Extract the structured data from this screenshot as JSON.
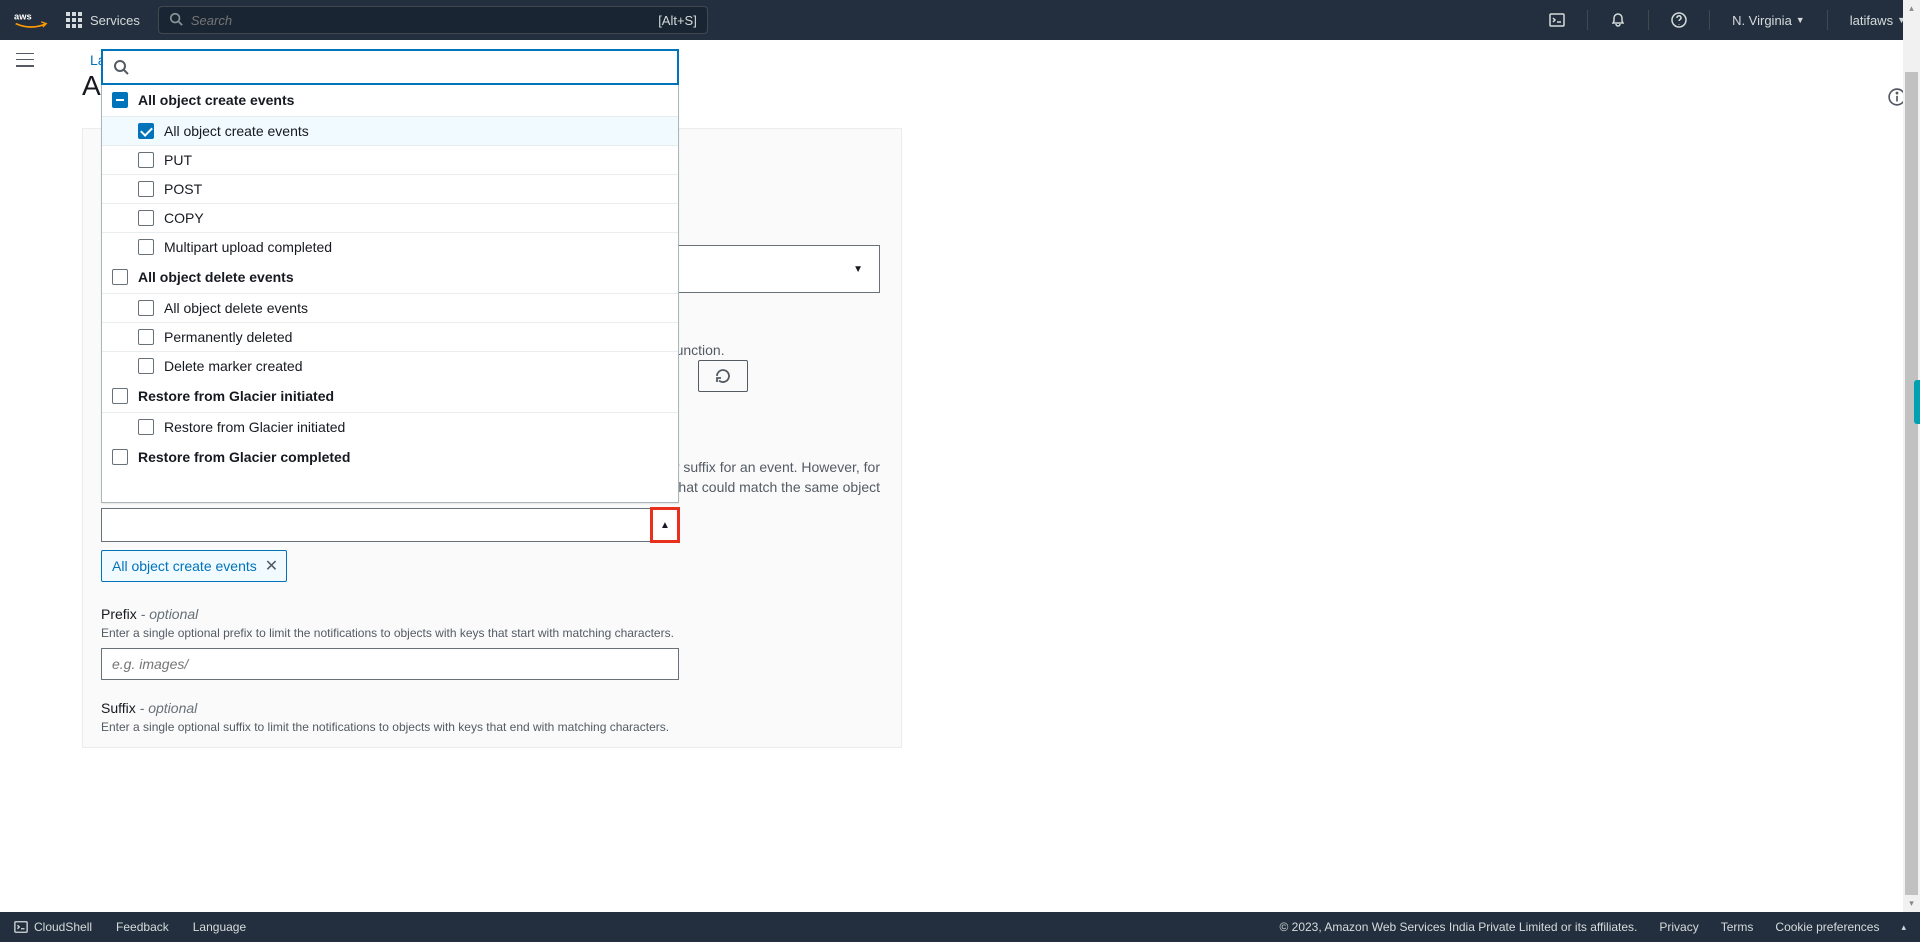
{
  "nav": {
    "services": "Services",
    "search_placeholder": "Search",
    "search_kbd": "[Alt+S]",
    "region": "N. Virginia",
    "user": "latifaws"
  },
  "breadcrumb": {
    "link": "La"
  },
  "page_title_partial": "A",
  "dropdown": {
    "groups": [
      {
        "label": "All object create events",
        "state": "indeterminate",
        "items": [
          {
            "label": "All object create events",
            "checked": true,
            "highlight": true
          },
          {
            "label": "PUT",
            "checked": false
          },
          {
            "label": "POST",
            "checked": false
          },
          {
            "label": "COPY",
            "checked": false
          },
          {
            "label": "Multipart upload completed",
            "checked": false
          }
        ]
      },
      {
        "label": "All object delete events",
        "state": "unchecked",
        "items": [
          {
            "label": "All object delete events",
            "checked": false
          },
          {
            "label": "Permanently deleted",
            "checked": false
          },
          {
            "label": "Delete marker created",
            "checked": false
          }
        ]
      },
      {
        "label": "Restore from Glacier initiated",
        "state": "unchecked",
        "items": [
          {
            "label": "Restore from Glacier initiated",
            "checked": false
          }
        ]
      },
      {
        "label": "Restore from Glacier completed",
        "state": "unchecked",
        "items": []
      }
    ]
  },
  "selected_token": "All object create events",
  "stub": {
    "text1": "e function.",
    "text2": "or suffix for an event. However, for that could match the same object"
  },
  "prefix": {
    "label": "Prefix",
    "optional": " - optional",
    "help": "Enter a single optional prefix to limit the notifications to objects with keys that start with matching characters.",
    "placeholder": "e.g. images/"
  },
  "suffix": {
    "label": "Suffix",
    "optional": " - optional",
    "help": "Enter a single optional suffix to limit the notifications to objects with keys that end with matching characters."
  },
  "footer": {
    "cloudshell": "CloudShell",
    "feedback": "Feedback",
    "language": "Language",
    "copyright": "© 2023, Amazon Web Services India Private Limited or its affiliates.",
    "privacy": "Privacy",
    "terms": "Terms",
    "cookies": "Cookie preferences"
  }
}
